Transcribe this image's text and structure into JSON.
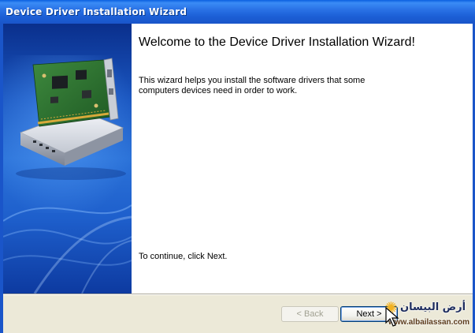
{
  "window": {
    "title": "Device Driver Installation Wizard"
  },
  "side_panel": {
    "illustration": "network-card-icon",
    "colors": {
      "top": "#0a2f8c",
      "middle": "#2b72d8",
      "bottom": "#0d3aa0"
    }
  },
  "content": {
    "heading": "Welcome to the Device Driver Installation Wizard!",
    "intro": "This wizard helps you install the software drivers that some computers devices need in order to work.",
    "continue": "To continue, click Next."
  },
  "buttons": {
    "back_label": "< Back",
    "next_label": "Next >"
  },
  "watermark": {
    "arabic": "أرض البيسان",
    "url": "www.albailassan.com"
  },
  "colors": {
    "titlebar": "#1b5fd6",
    "dialog_bg": "#ece9d8",
    "content_bg": "#ffffff"
  }
}
